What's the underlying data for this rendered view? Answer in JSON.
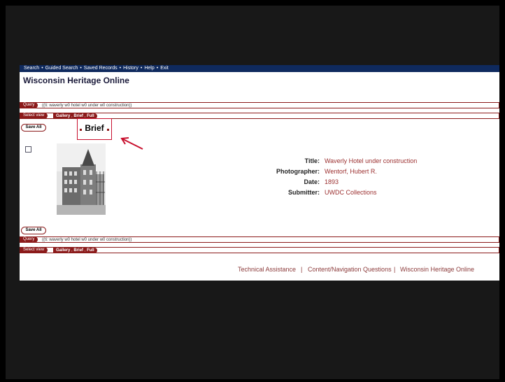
{
  "nav": {
    "items": [
      "Search",
      "Guided Search",
      "Saved Records",
      "History",
      "Help",
      "Exit"
    ],
    "separator": "•"
  },
  "site_title": "Wisconsin Heritage Online",
  "query_bar": {
    "label": "Query",
    "text": "((ti: waverly w0 hotel w0 under w0 construction))"
  },
  "view_bar": {
    "label": "Select view",
    "links": [
      "Gallery",
      "Brief",
      "Full"
    ]
  },
  "save_all_label": "Save All",
  "highlight_label": "Brief",
  "record": {
    "fields": [
      {
        "label": "Title:",
        "value": "Waverly Hotel under construction"
      },
      {
        "label": "Photographer:",
        "value": "Wentorf, Hubert R."
      },
      {
        "label": "Date:",
        "value": "1893"
      },
      {
        "label": "Submitter:",
        "value": "UWDC Collections"
      }
    ]
  },
  "footer": {
    "links": [
      "Technical Assistance",
      "Content/Navigation Questions",
      "Wisconsin Heritage Online"
    ],
    "separator": "|"
  },
  "colors": {
    "nav_bg": "#0f2a5e",
    "accent": "#8b1a1a",
    "highlight": "#c8102e",
    "slide_bg": "#181818"
  }
}
